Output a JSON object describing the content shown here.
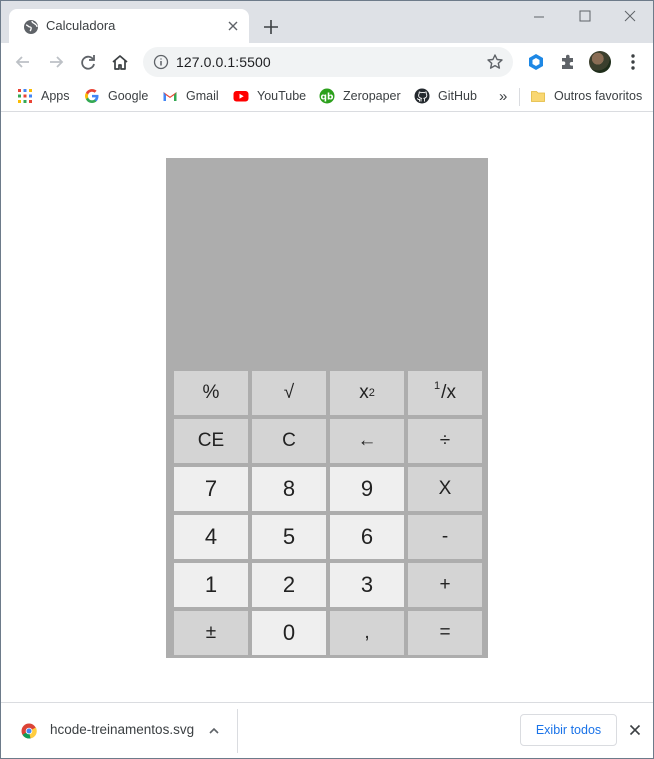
{
  "browser": {
    "tab": {
      "title": "Calculadora",
      "favicon": "globe-icon"
    },
    "address": {
      "url": "127.0.0.1:5500"
    },
    "bookmarks": [
      {
        "label": "Apps",
        "icon": "apps-grid-icon"
      },
      {
        "label": "Google",
        "icon": "google-icon"
      },
      {
        "label": "Gmail",
        "icon": "gmail-icon"
      },
      {
        "label": "YouTube",
        "icon": "youtube-icon"
      },
      {
        "label": "Zeropaper",
        "icon": "zeropaper-icon"
      },
      {
        "label": "GitHub",
        "icon": "github-icon"
      }
    ],
    "overflow_label": "»",
    "other_bookmarks": {
      "label": "Outros favoritos",
      "icon": "folder-icon"
    }
  },
  "calculator": {
    "display_value": "",
    "keys": [
      {
        "label": "%",
        "kind": "op",
        "name": "percent"
      },
      {
        "label": "√",
        "kind": "op",
        "name": "sqrt"
      },
      {
        "label": "x",
        "sup": "2",
        "kind": "op",
        "name": "square"
      },
      {
        "label": "/x",
        "pre_sup": "1",
        "kind": "op",
        "name": "reciprocal"
      },
      {
        "label": "CE",
        "kind": "op",
        "name": "clear-entry"
      },
      {
        "label": "C",
        "kind": "op",
        "name": "clear"
      },
      {
        "label": "←",
        "kind": "op",
        "name": "backspace"
      },
      {
        "label": "÷",
        "kind": "op",
        "name": "divide"
      },
      {
        "label": "7",
        "kind": "num",
        "name": "7"
      },
      {
        "label": "8",
        "kind": "num",
        "name": "8"
      },
      {
        "label": "9",
        "kind": "num",
        "name": "9"
      },
      {
        "label": "X",
        "kind": "op",
        "name": "multiply"
      },
      {
        "label": "4",
        "kind": "num",
        "name": "4"
      },
      {
        "label": "5",
        "kind": "num",
        "name": "5"
      },
      {
        "label": "6",
        "kind": "num",
        "name": "6"
      },
      {
        "label": "-",
        "kind": "op",
        "name": "subtract"
      },
      {
        "label": "1",
        "kind": "num",
        "name": "1"
      },
      {
        "label": "2",
        "kind": "num",
        "name": "2"
      },
      {
        "label": "3",
        "kind": "num",
        "name": "3"
      },
      {
        "label": "+",
        "kind": "op",
        "name": "add"
      },
      {
        "label": "±",
        "kind": "op",
        "name": "negate"
      },
      {
        "label": "0",
        "kind": "num",
        "name": "0"
      },
      {
        "label": ",",
        "kind": "op",
        "name": "decimal"
      },
      {
        "label": "=",
        "kind": "op",
        "name": "equals"
      }
    ]
  },
  "download": {
    "file_name": "hcode-treinamentos.svg",
    "show_all_label": "Exibir todos"
  },
  "colors": {
    "calculator_bg": "#adadad",
    "op_key": "#d4d4d4",
    "num_key": "#efefef",
    "accent_link": "#1a73e8"
  }
}
